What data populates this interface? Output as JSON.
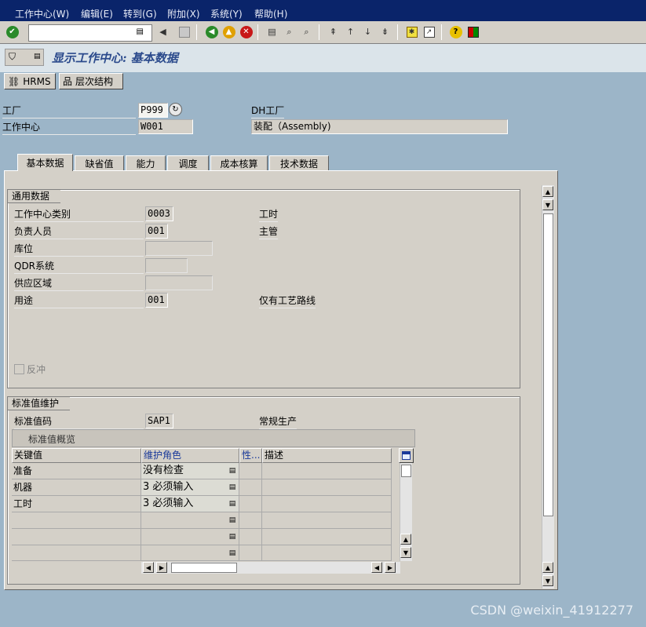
{
  "menu": {
    "items": [
      "工作中心(W)",
      "编辑(E)",
      "转到(G)",
      "附加(X)",
      "系统(Y)",
      "帮助(H)"
    ]
  },
  "toolbar": {
    "command_value": "",
    "icons": [
      "enter-icon",
      "save-icon",
      "back-icon",
      "exit-icon",
      "cancel-icon",
      "print-icon",
      "find-icon",
      "find-next-icon",
      "first-page-icon",
      "prev-page-icon",
      "next-page-icon",
      "last-page-icon",
      "new-session-icon",
      "shortcut-icon",
      "help-icon",
      "layout-icon"
    ]
  },
  "title": "显示工作中心: 基本数据",
  "app_toolbar": {
    "hrms_label": "HRMS",
    "hierarchy_label": "层次结构"
  },
  "header": {
    "plant_label": "工厂",
    "plant_value": "P999",
    "plant_desc": "DH工厂",
    "workcenter_label": "工作中心",
    "workcenter_value": "W001",
    "workcenter_desc": "装配（Assembly)"
  },
  "tabs": [
    "基本数据",
    "缺省值",
    "能力",
    "调度",
    "成本核算",
    "技术数据"
  ],
  "general": {
    "title": "通用数据",
    "rows": [
      {
        "label": "工作中心类别",
        "value": "0003",
        "desc": "工时"
      },
      {
        "label": "负责人员",
        "value": "001",
        "desc": "主管"
      },
      {
        "label": "库位",
        "value": "",
        "desc": ""
      },
      {
        "label": "QDR系统",
        "value": "",
        "desc": ""
      },
      {
        "label": "供应区域",
        "value": "",
        "desc": ""
      },
      {
        "label": "用途",
        "value": "001",
        "desc": "仅有工艺路线"
      }
    ],
    "backflush_label": "反冲",
    "backflush_checked": false
  },
  "standard": {
    "title": "标准值维护",
    "key_label": "标准值码",
    "key_value": "SAP1",
    "key_desc": "常规生产",
    "overview_title": "标准值概览",
    "columns": [
      "关键值",
      "维护角色",
      "性...",
      "描述"
    ],
    "rows": [
      {
        "key": "准备",
        "role": " 没有检查"
      },
      {
        "key": "机器",
        "role": "3 必须输入"
      },
      {
        "key": "工时",
        "role": "3 必须输入"
      },
      {
        "key": "",
        "role": ""
      },
      {
        "key": "",
        "role": ""
      },
      {
        "key": "",
        "role": ""
      }
    ]
  },
  "watermark": "CSDN @weixin_41912277"
}
